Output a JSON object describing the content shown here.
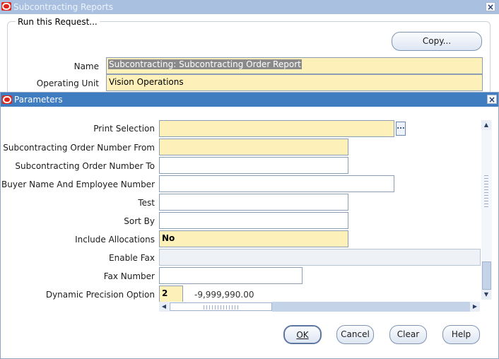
{
  "request_window": {
    "title": "Subcontracting Reports",
    "group_label": "Run this Request...",
    "copy_label": "Copy...",
    "name_label": "Name",
    "name_value": "Subcontracting: Subcontracting Order Report",
    "operating_unit_label": "Operating Unit",
    "operating_unit_value": "Vision Operations"
  },
  "parameters_window": {
    "title": "Parameters",
    "fields": [
      {
        "label": "Print Selection",
        "value": ""
      },
      {
        "label": "Subcontracting Order Number From",
        "value": ""
      },
      {
        "label": "Subcontracting Order Number To",
        "value": ""
      },
      {
        "label": "Buyer Name And Employee Number",
        "value": ""
      },
      {
        "label": "Test",
        "value": ""
      },
      {
        "label": "Sort By",
        "value": ""
      },
      {
        "label": "Include Allocations",
        "value": "No"
      },
      {
        "label": "Enable Fax",
        "value": ""
      },
      {
        "label": "Fax Number",
        "value": ""
      },
      {
        "label": "Dynamic Precision Option",
        "value": "2"
      }
    ],
    "precision_sample": "-9,999,990.00",
    "lov_button": "...",
    "buttons": {
      "ok": "OK",
      "cancel": "Cancel",
      "clear": "Clear",
      "help": "Help"
    }
  },
  "colors": {
    "titlebar_inactive": "#a9c0e0",
    "titlebar_active": "#3f7cc0",
    "required_field": "#fdf0b8",
    "oracle_red": "#e2231a"
  },
  "icons": [
    "oracle-logo-icon",
    "close-icon",
    "lov-ellipsis-icon",
    "scroll-up-icon",
    "scroll-down-icon",
    "scroll-left-icon",
    "scroll-right-icon"
  ]
}
